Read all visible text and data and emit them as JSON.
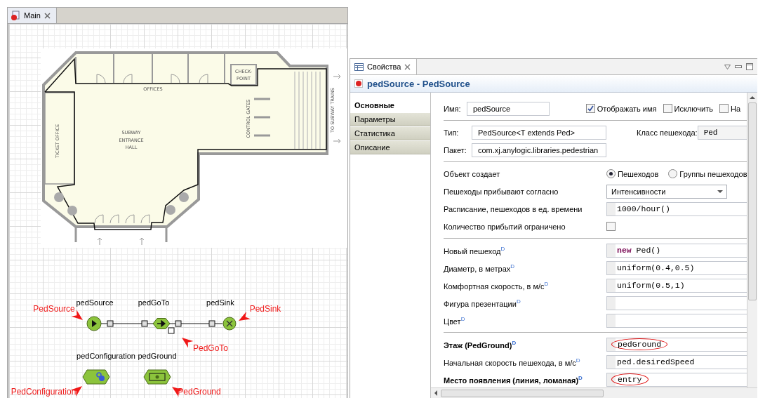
{
  "editor": {
    "tab": {
      "title": "Main"
    },
    "plan": {
      "offices": "OFFICES",
      "hall": [
        "SUBWAY",
        "ENTRANCE",
        "HALL"
      ],
      "ticket_office": "TICKET OFFICE",
      "control_gates": "CONTROL GATES",
      "checkpoint": [
        "CHECK-",
        "POINT"
      ],
      "exit": "TO SUBWAY TRAINS"
    },
    "blocks": [
      {
        "kind": "source",
        "name": "pedSource",
        "callout": "PedSource"
      },
      {
        "kind": "goto",
        "name": "pedGoTo",
        "callout": "PedGoTo"
      },
      {
        "kind": "sink",
        "name": "pedSink",
        "callout": "PedSink"
      },
      {
        "kind": "configuration",
        "name": "pedConfiguration",
        "callout": "PedConfiguration"
      },
      {
        "kind": "ground",
        "name": "pedGround",
        "callout": "PedGround"
      }
    ]
  },
  "properties": {
    "tab": {
      "title": "Свойства"
    },
    "title": "pedSource - PedSource",
    "sections": [
      {
        "label": "Основные",
        "selected": true
      },
      {
        "label": "Параметры",
        "selected": false
      },
      {
        "label": "Статистика",
        "selected": false
      },
      {
        "label": "Описание",
        "selected": false
      }
    ],
    "name": {
      "label": "Имя:",
      "value": "pedSource"
    },
    "options": [
      {
        "label": "Отображать имя",
        "checked": true
      },
      {
        "label": "Исключить",
        "checked": false
      },
      {
        "label": "На",
        "checked": false
      }
    ],
    "type": {
      "label": "Тип:",
      "value": "PedSource<T extends Ped>"
    },
    "package": {
      "label": "Пакет:",
      "value": "com.xj.anylogic.libraries.pedestrian"
    },
    "ped_class": {
      "label": "Класс пешехода:",
      "value": "Ped"
    },
    "groups": [
      [
        {
          "kind": "radio",
          "label": "Объект создает",
          "options": [
            {
              "label": "Пешеходов",
              "selected": true
            },
            {
              "label": "Группы пешеходов",
              "selected": false
            }
          ]
        },
        {
          "kind": "dropdown",
          "label": "Пешеходы прибывают согласно",
          "value": "Интенсивности"
        },
        {
          "kind": "code",
          "label": "Расписание, пешеходов в ед. времени",
          "value": "1000/hour()"
        },
        {
          "kind": "checkbox",
          "label": "Количество прибытий ограничено",
          "checked": false
        }
      ],
      [
        {
          "kind": "code",
          "label": "Новый пешеход$^{D}$",
          "value": "**new** Ped()"
        },
        {
          "kind": "code",
          "label": "Диаметр, в метрах$^{D}$",
          "value": "uniform(0.4,0.5)"
        },
        {
          "kind": "code",
          "label": "Комфортная скорость, в м/с$^{D}$",
          "value": "uniform(0.5,1)"
        },
        {
          "kind": "code",
          "label": "Фигура презентации$^{D}$"
        },
        {
          "kind": "code",
          "label": "Цвет$^{D}$"
        }
      ],
      [
        {
          "kind": "code",
          "label": "Этаж (PedGround)$^{D}$",
          "bold": true,
          "value": "pedGround",
          "circled": true
        },
        {
          "kind": "code",
          "label": "Начальная скорость пешехода, в м/с$^{D}$",
          "value": "ped.desiredSpeed"
        },
        {
          "kind": "code",
          "label": "Место появления (линия, ломаная)$^{D}$",
          "bold": true,
          "value": "entry",
          "circled": true
        }
      ]
    ]
  }
}
